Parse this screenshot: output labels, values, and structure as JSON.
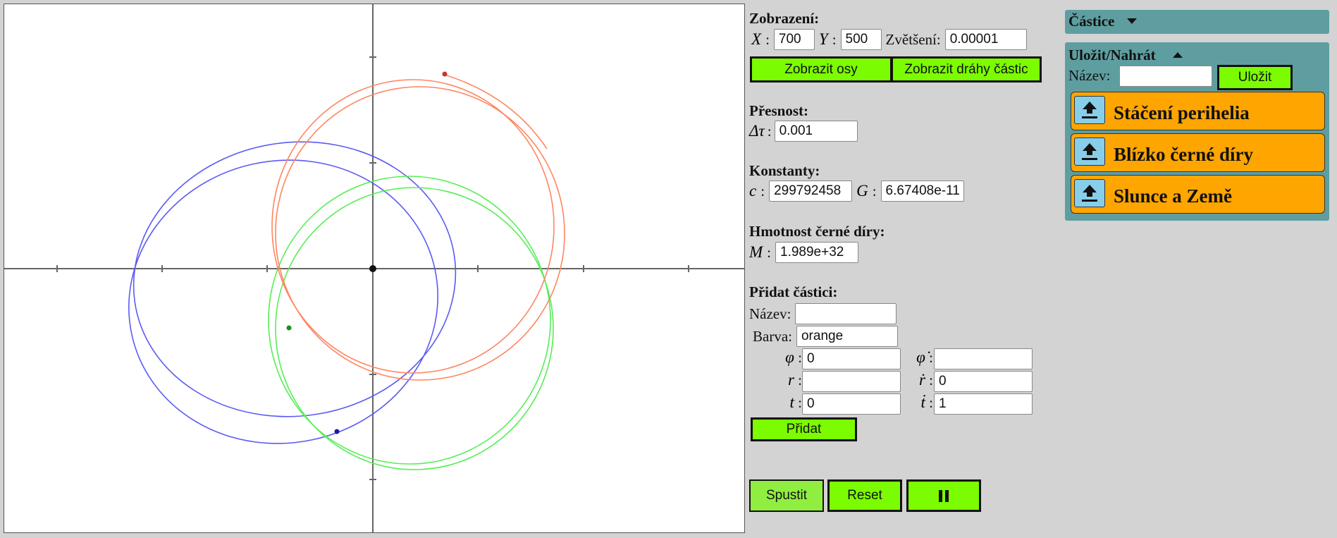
{
  "display": {
    "title": "Zobrazení:",
    "x_label": "X",
    "x_value": "700",
    "y_label": "Y",
    "y_value": "500",
    "zoom_label": "Zvětšení:",
    "zoom_value": "0.00001",
    "show_axes": "Zobrazit osy",
    "show_paths": "Zobrazit dráhy částic"
  },
  "precision": {
    "title": "Přesnost:",
    "dtau_label": "Δτ",
    "dtau_value": "0.001"
  },
  "constants": {
    "title": "Konstanty:",
    "c_label": "c",
    "c_value": "299792458",
    "g_label": "G",
    "g_value": "6.67408e-11"
  },
  "mass": {
    "title": "Hmotnost černé díry:",
    "m_label": "M",
    "m_value": "1.989e+32"
  },
  "add_particle": {
    "title": "Přidat částici:",
    "name_label": "Název:",
    "name_value": "",
    "color_label": "Barva:",
    "color_value": "orange",
    "phi_label": "φ",
    "phi_value": "0",
    "phidot_label": "φ̇",
    "phidot_value": "",
    "r_label": "r",
    "r_value": "",
    "rdot_label": "ṙ",
    "rdot_value": "0",
    "t_label": "t",
    "t_value": "0",
    "tdot_label": "ṫ",
    "tdot_value": "1",
    "add_button": "Přidat"
  },
  "controls": {
    "start": "Spustit",
    "reset": "Reset",
    "pause_icon": "pause-icon"
  },
  "particles_panel": {
    "title": "Částice",
    "caret_icon": "caret-down-icon"
  },
  "save_panel": {
    "title": "Uložit/Nahrát",
    "caret_icon": "caret-up-icon",
    "name_label": "Název:",
    "name_value": "",
    "save_button": "Uložit",
    "presets": [
      {
        "label": "Stáčení perihelia",
        "icon": "upload-icon"
      },
      {
        "label": "Blízko černé díry",
        "icon": "upload-icon"
      },
      {
        "label": "Slunce a Země",
        "icon": "upload-icon"
      }
    ]
  },
  "colors": {
    "background": "#d3d3d3",
    "button_green": "#7cfc00",
    "panel_teal": "#5f9ea0",
    "preset_orange": "#ffa500",
    "orbit_blue": "#5555ff",
    "orbit_green": "#55ee55",
    "orbit_orange": "#ff7f50"
  }
}
